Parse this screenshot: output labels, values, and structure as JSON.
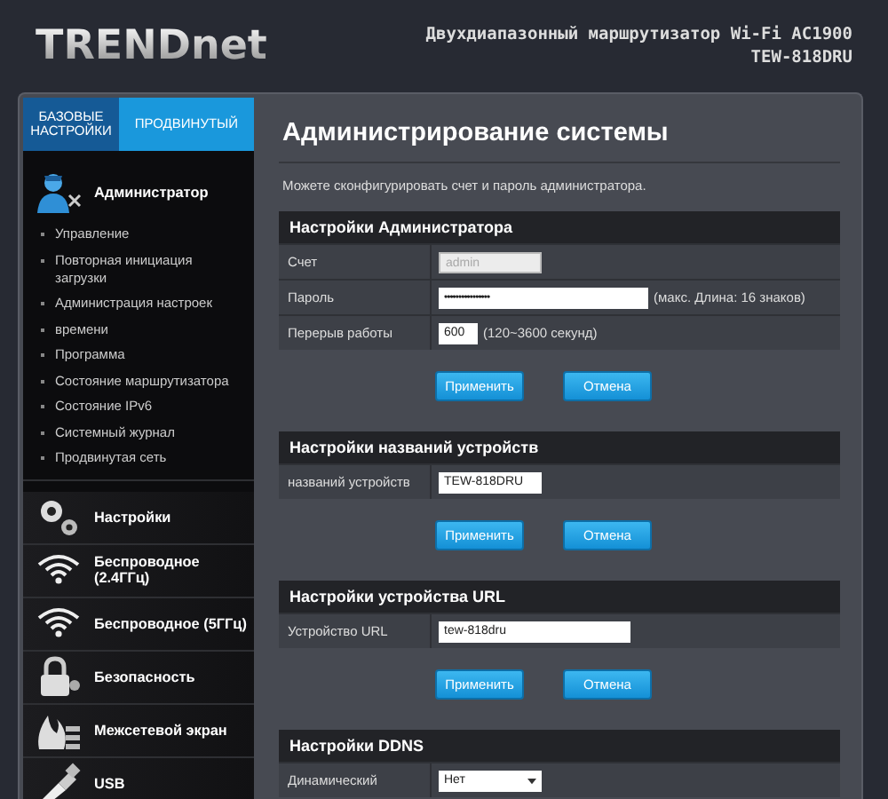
{
  "header": {
    "logo": "TRENDnet",
    "product": "Двухдиапазонный маршрутизатор Wi-Fi AC1900",
    "model": "TEW-818DRU"
  },
  "tabs": [
    {
      "label": "БАЗОВЫЕ НАСТРОЙКИ",
      "selected": false
    },
    {
      "label": "ПРОДВИНУТЫЙ",
      "selected": true
    }
  ],
  "sidebar": {
    "items": [
      {
        "label": "Администратор",
        "expanded": true,
        "children": [
          {
            "label": "Управление"
          },
          {
            "label": "Повторная инициация загрузки"
          },
          {
            "label": "Администрация настроек"
          },
          {
            "label": "времени"
          },
          {
            "label": "Программа"
          },
          {
            "label": "Состояние маршрутизатора"
          },
          {
            "label": "Состояние IPv6"
          },
          {
            "label": "Системный журнал"
          },
          {
            "label": "Продвинутая сеть"
          }
        ]
      },
      {
        "label": "Настройки",
        "expanded": false
      },
      {
        "label": "Беспроводное (2.4ГГц)",
        "expanded": false
      },
      {
        "label": "Беспроводное (5ГГц)",
        "expanded": false
      },
      {
        "label": "Безопасность",
        "expanded": false
      },
      {
        "label": "Межсетевой экран",
        "expanded": false
      },
      {
        "label": "USB",
        "expanded": false
      }
    ]
  },
  "page": {
    "title": "Администрирование системы",
    "description": "Можете сконфигурировать счет и пароль администратора.",
    "sections": [
      {
        "title": "Настройки Администратора",
        "rows": [
          {
            "label": "Счет",
            "kind": "text",
            "value": "admin",
            "disabled": true
          },
          {
            "label": "Пароль",
            "kind": "password",
            "value": "••••••••••••••••",
            "hint": "(макс. Длина: 16 знаков)"
          },
          {
            "label": "Перерыв работы",
            "kind": "short",
            "value": "600",
            "hint": "(120~3600 секунд)"
          }
        ],
        "buttons": [
          "Применить",
          "Отмена"
        ]
      },
      {
        "title": "Настройки названий устройств",
        "rows": [
          {
            "label": "названий устройств",
            "kind": "text",
            "value": "TEW-818DRU"
          }
        ],
        "buttons": [
          "Применить",
          "Отмена"
        ]
      },
      {
        "title": "Настройки устройства URL",
        "rows": [
          {
            "label": "Устройство URL",
            "kind": "wide",
            "value": "tew-818dru"
          }
        ],
        "buttons": [
          "Применить",
          "Отмена"
        ]
      },
      {
        "title": "Настройки DDNS",
        "rows": [
          {
            "label": "Динамический",
            "kind": "select",
            "value": "Нет"
          }
        ]
      }
    ]
  }
}
